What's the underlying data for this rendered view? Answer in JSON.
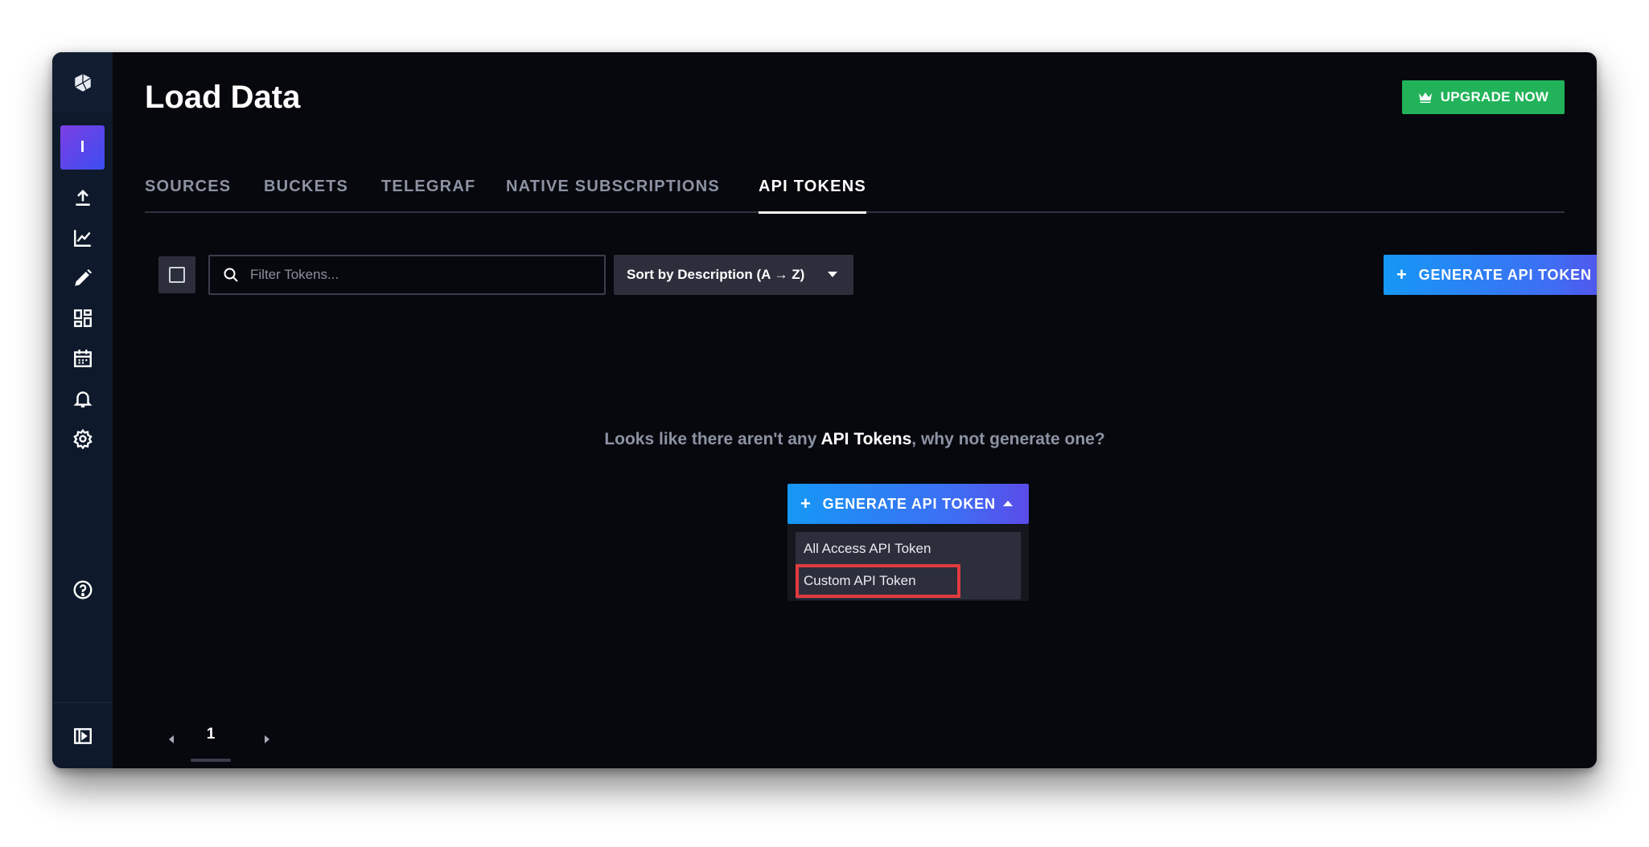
{
  "sidebar": {
    "logo_icon": "cube-logo-icon",
    "avatar_letter": "I",
    "items": [
      {
        "name": "load-data",
        "icon": "upload-icon"
      },
      {
        "name": "data-explorer",
        "icon": "chart-line-icon"
      },
      {
        "name": "notebooks",
        "icon": "pencil-icon"
      },
      {
        "name": "dashboards",
        "icon": "dashboard-icon"
      },
      {
        "name": "tasks",
        "icon": "calendar-icon"
      },
      {
        "name": "alerts",
        "icon": "bell-icon"
      },
      {
        "name": "settings",
        "icon": "gear-icon"
      },
      {
        "name": "help",
        "icon": "question-icon"
      },
      {
        "name": "collapse",
        "icon": "collapse-sidebar-icon"
      }
    ]
  },
  "header": {
    "title": "Load Data",
    "upgrade_label": "UPGRADE NOW",
    "upgrade_color": "#22b35a"
  },
  "tabs": [
    {
      "label": "SOURCES",
      "active": false
    },
    {
      "label": "BUCKETS",
      "active": false
    },
    {
      "label": "TELEGRAF",
      "active": false
    },
    {
      "label": "NATIVE SUBSCRIPTIONS",
      "active": false
    },
    {
      "label": "API TOKENS",
      "active": true
    }
  ],
  "toolbar": {
    "filter_placeholder": "Filter Tokens...",
    "sort_label": "Sort by Description (A → Z)",
    "generate_label": "GENERATE API TOKEN"
  },
  "empty_state": {
    "prefix": "Looks like there aren't any ",
    "highlight": "API Tokens",
    "suffix": ", why not generate one?",
    "generate_label": "GENERATE API TOKEN",
    "menu_items": [
      "All Access API Token",
      "Custom API Token"
    ]
  },
  "pagination": {
    "current_page": "1"
  },
  "colors": {
    "background": "#07080d",
    "sidebar": "#0e1a2b",
    "highlight_border": "#e03a3e",
    "button_gradient_start": "#1598f5",
    "button_gradient_end": "#5b4be8"
  }
}
